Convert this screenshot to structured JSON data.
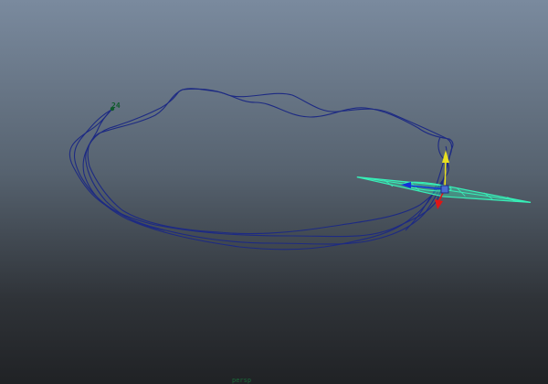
{
  "viewport": {
    "start_label": "24",
    "bottom_label": "persp",
    "colors": {
      "curve": "#1d2a83",
      "selection": "#37f0b8",
      "manip_x": "#1330d8",
      "manip_y": "#e8e020",
      "manip_z": "#e01515",
      "label": "#0f5a2c"
    },
    "icons": [
      "move-manipulator-icon",
      "plane-object-icon",
      "motion-path-icon"
    ]
  }
}
